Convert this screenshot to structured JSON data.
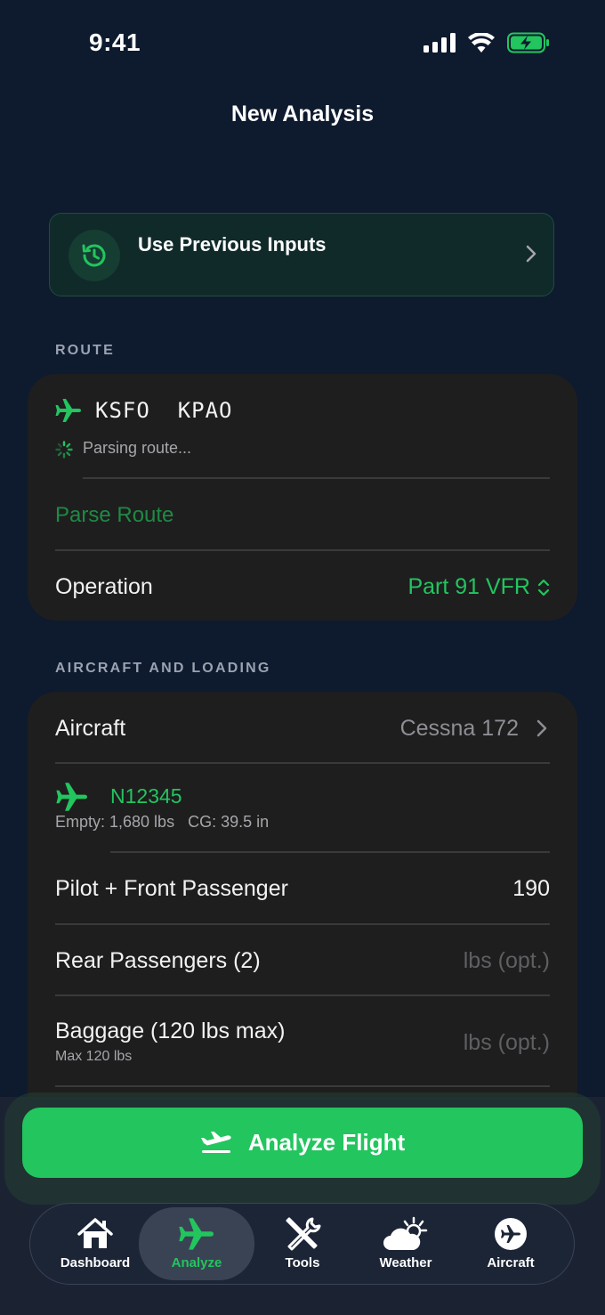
{
  "status_bar": {
    "time": "9:41"
  },
  "header": {
    "title": "New Analysis"
  },
  "previous_inputs": {
    "label": "Use Previous Inputs"
  },
  "route_section": {
    "label": "ROUTE",
    "route_text": "KSFO  KPAO",
    "parsing_text": "Parsing route...",
    "parse_button": "Parse Route",
    "operation_label": "Operation",
    "operation_value": "Part 91 VFR"
  },
  "aircraft_section": {
    "label": "AIRCRAFT AND LOADING",
    "aircraft_label": "Aircraft",
    "aircraft_value": "Cessna 172",
    "tail_number": "N12345",
    "tail_details": "Empty: 1,680 lbs   CG: 39.5 in",
    "pilot_label": "Pilot + Front Passenger",
    "pilot_value": "190",
    "rear_label": "Rear Passengers (2)",
    "rear_placeholder": "lbs (opt.)",
    "baggage_label": "Baggage (120 lbs max)",
    "baggage_sub": "Max 120 lbs",
    "baggage_placeholder": "lbs (opt.)"
  },
  "analyze_button": {
    "label": "Analyze Flight"
  },
  "tab_bar": {
    "items": [
      {
        "label": "Dashboard",
        "icon": "house-icon"
      },
      {
        "label": "Analyze",
        "icon": "airplane-icon"
      },
      {
        "label": "Tools",
        "icon": "tools-icon"
      },
      {
        "label": "Weather",
        "icon": "cloud-sun-icon"
      },
      {
        "label": "Aircraft",
        "icon": "airplane-circle-icon"
      }
    ],
    "active_index": 1
  },
  "colors": {
    "accent": "#22c55e",
    "background": "#0e1a2e",
    "card": "#1e1e1f"
  }
}
